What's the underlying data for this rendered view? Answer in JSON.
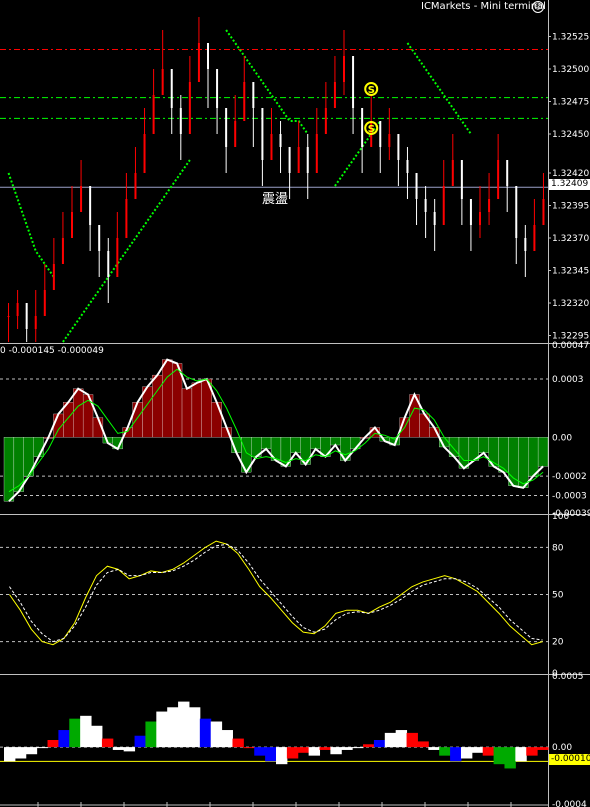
{
  "app": {
    "title": "ICMarkets - Mini terminal"
  },
  "annotations": {
    "chop_label": "震盪",
    "signal_marker": "S"
  },
  "colors": {
    "background": "#000000",
    "grid_line": "#c0c0c0",
    "candle_bull": "#ff0000",
    "candle_bear": "#ffffff",
    "band_line": "#00ff00",
    "level_red": "#ff0000",
    "level_green": "#00ff00",
    "signal_marker": "#ffff00",
    "histo_up": "#8b0000",
    "histo_down": "#008000",
    "osc_line_main": "#ffff00",
    "osc_line_signal": "#ffffff",
    "bar_red": "#ff0000",
    "bar_blue": "#0000ff",
    "bar_green": "#00aa00",
    "bar_white": "#ffffff",
    "zero_line": "#ffff00"
  },
  "chart_data": [
    {
      "type": "candlestick",
      "panel": "price",
      "ylim": [
        1.3229,
        1.3255
      ],
      "y_ticks": [
        "1.32525",
        "1.32500",
        "1.32475",
        "1.32450",
        "1.32420",
        "1.32395",
        "1.32370",
        "1.32345",
        "1.32320",
        "1.32295"
      ],
      "current_price": "1.32409",
      "current_value": 1.32409,
      "levels": [
        {
          "value": 1.32515,
          "color": "red"
        },
        {
          "value": 1.32478,
          "color": "green"
        },
        {
          "value": 1.32462,
          "color": "green"
        }
      ],
      "close": [
        1.3231,
        1.3232,
        1.323,
        1.3231,
        1.3233,
        1.3235,
        1.3237,
        1.3239,
        1.3241,
        1.3238,
        1.3236,
        1.3234,
        1.3237,
        1.324,
        1.3242,
        1.3245,
        1.3248,
        1.325,
        1.3247,
        1.3245,
        1.3249,
        1.3252,
        1.325,
        1.3247,
        1.3244,
        1.3246,
        1.3249,
        1.3247,
        1.3243,
        1.3245,
        1.3244,
        1.3242,
        1.3244,
        1.3242,
        1.3245,
        1.3247,
        1.3249,
        1.3251,
        1.3247,
        1.3244,
        1.3246,
        1.3244,
        1.3245,
        1.3243,
        1.3242,
        1.324,
        1.3239,
        1.3238,
        1.3241,
        1.3243,
        1.324,
        1.3238,
        1.3239,
        1.324,
        1.3243,
        1.3241,
        1.3237,
        1.3236,
        1.3238,
        1.324
      ],
      "high": [
        1.3232,
        1.3233,
        1.3232,
        1.3233,
        1.3235,
        1.3237,
        1.3239,
        1.3241,
        1.3243,
        1.3241,
        1.3238,
        1.3237,
        1.3239,
        1.3242,
        1.3244,
        1.3247,
        1.325,
        1.3253,
        1.325,
        1.3248,
        1.3251,
        1.3254,
        1.3252,
        1.325,
        1.3247,
        1.3248,
        1.3251,
        1.3249,
        1.3246,
        1.3247,
        1.3246,
        1.3244,
        1.3246,
        1.3245,
        1.3247,
        1.3249,
        1.3251,
        1.3253,
        1.325,
        1.3246,
        1.3248,
        1.3246,
        1.3247,
        1.3245,
        1.3244,
        1.3242,
        1.3241,
        1.324,
        1.3243,
        1.3245,
        1.3242,
        1.324,
        1.3241,
        1.3242,
        1.3245,
        1.3243,
        1.324,
        1.3238,
        1.324,
        1.3242
      ],
      "low": [
        1.3229,
        1.323,
        1.3229,
        1.3229,
        1.3231,
        1.3233,
        1.3235,
        1.3237,
        1.3239,
        1.3236,
        1.3234,
        1.3232,
        1.3235,
        1.3238,
        1.324,
        1.3243,
        1.3246,
        1.3248,
        1.3245,
        1.3243,
        1.3247,
        1.325,
        1.3247,
        1.3245,
        1.3242,
        1.3244,
        1.3247,
        1.3244,
        1.3241,
        1.3243,
        1.3242,
        1.324,
        1.3242,
        1.324,
        1.3243,
        1.3245,
        1.3247,
        1.3248,
        1.3245,
        1.3242,
        1.3244,
        1.3242,
        1.3243,
        1.3241,
        1.324,
        1.3238,
        1.3237,
        1.3236,
        1.3239,
        1.3241,
        1.3238,
        1.3236,
        1.3237,
        1.3238,
        1.3241,
        1.3239,
        1.3235,
        1.3234,
        1.3236,
        1.3238
      ],
      "bands": [
        {
          "start": 0,
          "values": [
            1.3242,
            1.324,
            1.3238,
            1.3236,
            1.3235,
            1.3234
          ]
        },
        {
          "start": 6,
          "values": [
            1.3229,
            1.323,
            1.3231,
            1.3232,
            1.3233,
            1.3234,
            1.3235,
            1.3236,
            1.3237,
            1.3238,
            1.3239,
            1.324,
            1.3241,
            1.3242,
            1.3243
          ]
        },
        {
          "start": 24,
          "values": [
            1.3253,
            1.3252,
            1.3251,
            1.325,
            1.3249,
            1.3248,
            1.3247,
            1.3246,
            1.3246,
            1.3245
          ]
        },
        {
          "start": 36,
          "values": [
            1.3241,
            1.3242,
            1.3243,
            1.3244,
            1.3245,
            1.3246
          ]
        },
        {
          "start": 44,
          "values": [
            1.3252,
            1.3251,
            1.325,
            1.3249,
            1.3248,
            1.3247,
            1.3246,
            1.3245
          ]
        }
      ]
    },
    {
      "type": "histogram",
      "panel": "macd_histogram",
      "title": "0 -0.000145 -0.000049",
      "ylim": [
        -0.00039,
        0.000475
      ],
      "y_ticks": [
        "0.000475",
        "0.0003",
        "0.00",
        "-0.0002",
        "-0.0003",
        "-0.00039"
      ],
      "y_tick_values": [
        0.000475,
        0.0003,
        0.0,
        -0.0002,
        -0.0003,
        -0.00039
      ],
      "dashed_levels": [
        0.0003,
        -0.0002,
        -0.0003
      ],
      "values": [
        -0.00033,
        -0.00028,
        -0.0002,
        -0.0001,
        0.0,
        0.00012,
        0.00018,
        0.00025,
        0.00022,
        0.0001,
        -3e-05,
        -6e-05,
        5e-05,
        0.00018,
        0.00026,
        0.00032,
        0.0004,
        0.00038,
        0.00025,
        0.00028,
        0.0003,
        0.00018,
        5e-05,
        -8e-05,
        -0.00018,
        -0.0001,
        -6e-05,
        -0.00012,
        -0.00015,
        -8e-05,
        -0.00014,
        -6e-05,
        -0.0001,
        -4e-05,
        -0.00012,
        -6e-05,
        0.0,
        5e-05,
        -2e-05,
        -4e-05,
        0.0001,
        0.00022,
        0.00012,
        5e-05,
        -5e-05,
        -0.0001,
        -0.00016,
        -0.00012,
        -8e-05,
        -0.00015,
        -0.00018,
        -0.00025,
        -0.00026,
        -0.0002,
        -0.00015
      ],
      "signal": [
        -0.00028,
        -0.00025,
        -0.0002,
        -0.00013,
        -6e-05,
        4e-05,
        0.0001,
        0.00016,
        0.00019,
        0.00016,
        9e-05,
        2e-05,
        3e-05,
        0.0001,
        0.00017,
        0.00024,
        0.00031,
        0.00035,
        0.00031,
        0.00029,
        0.0003,
        0.00024,
        0.00015,
        4e-05,
        -8e-05,
        -0.00011,
        -0.0001,
        -0.00011,
        -0.00013,
        -0.00011,
        -0.00012,
        -9e-05,
        -0.0001,
        -7e-05,
        -9e-05,
        -7e-05,
        -3e-05,
        2e-05,
        1e-05,
        -1e-05,
        5e-05,
        0.00015,
        0.00014,
        9e-05,
        0.0,
        -6e-05,
        -0.00012,
        -0.00012,
        -0.0001,
        -0.00013,
        -0.00016,
        -0.00021,
        -0.00024,
        -0.00022,
        -0.00018
      ]
    },
    {
      "type": "line",
      "panel": "oscillator",
      "ylim": [
        0,
        100
      ],
      "y_ticks": [
        "100",
        "80",
        "50",
        "20",
        "0"
      ],
      "y_tick_values": [
        100,
        80,
        50,
        20,
        0
      ],
      "dashed_levels": [
        80,
        50,
        20
      ],
      "series": [
        {
          "values": [
            50,
            40,
            28,
            20,
            18,
            22,
            32,
            48,
            62,
            68,
            66,
            60,
            62,
            65,
            64,
            66,
            70,
            75,
            80,
            84,
            82,
            76,
            66,
            55,
            48,
            40,
            32,
            26,
            25,
            30,
            38,
            40,
            40,
            38,
            42,
            45,
            50,
            55,
            58,
            60,
            62,
            60,
            56,
            52,
            45,
            38,
            30,
            24,
            18,
            20
          ]
        },
        {
          "values": [
            55,
            45,
            33,
            25,
            20,
            22,
            30,
            42,
            56,
            64,
            66,
            62,
            62,
            64,
            64,
            65,
            68,
            72,
            77,
            81,
            82,
            78,
            70,
            60,
            52,
            44,
            36,
            29,
            26,
            28,
            34,
            38,
            39,
            38,
            40,
            43,
            47,
            52,
            56,
            58,
            60,
            60,
            58,
            54,
            48,
            42,
            34,
            28,
            22,
            21
          ]
        }
      ]
    },
    {
      "type": "bar",
      "panel": "color_histogram",
      "ylim": [
        -0.0004,
        0.0005
      ],
      "y_ticks": [
        "0.0005",
        "0.00",
        "-0.0004"
      ],
      "y_tick_values": [
        0.0005,
        0.0,
        -0.0004
      ],
      "current_value": "-0.00010",
      "current_value_num": -0.0001,
      "values": [
        -0.0001,
        -8e-05,
        -5e-05,
        0.0,
        5e-05,
        0.00012,
        0.0002,
        0.00022,
        0.00015,
        6e-05,
        -2e-05,
        -3e-05,
        8e-05,
        0.00018,
        0.00025,
        0.00028,
        0.00032,
        0.00028,
        0.0002,
        0.00018,
        0.00012,
        6e-05,
        0.0,
        -6e-05,
        -0.0001,
        -0.00012,
        -8e-05,
        -4e-05,
        -6e-05,
        -2e-05,
        -5e-05,
        -2e-05,
        0.0,
        2e-05,
        5e-05,
        0.0001,
        0.00012,
        0.0001,
        4e-05,
        -2e-05,
        -6e-05,
        -0.0001,
        -8e-05,
        -4e-05,
        -6e-05,
        -0.00012,
        -0.00015,
        -0.0001,
        -6e-05,
        -2e-05
      ],
      "colors": [
        "white",
        "white",
        "white",
        "white",
        "red",
        "blue",
        "green",
        "white",
        "white",
        "red",
        "white",
        "white",
        "blue",
        "green",
        "white",
        "white",
        "white",
        "white",
        "blue",
        "white",
        "white",
        "red",
        "red",
        "blue",
        "blue",
        "white",
        "red",
        "red",
        "white",
        "red",
        "white",
        "white",
        "white",
        "red",
        "blue",
        "white",
        "white",
        "red",
        "red",
        "white",
        "green",
        "blue",
        "white",
        "white",
        "red",
        "green",
        "green",
        "white",
        "red",
        "red"
      ]
    }
  ]
}
